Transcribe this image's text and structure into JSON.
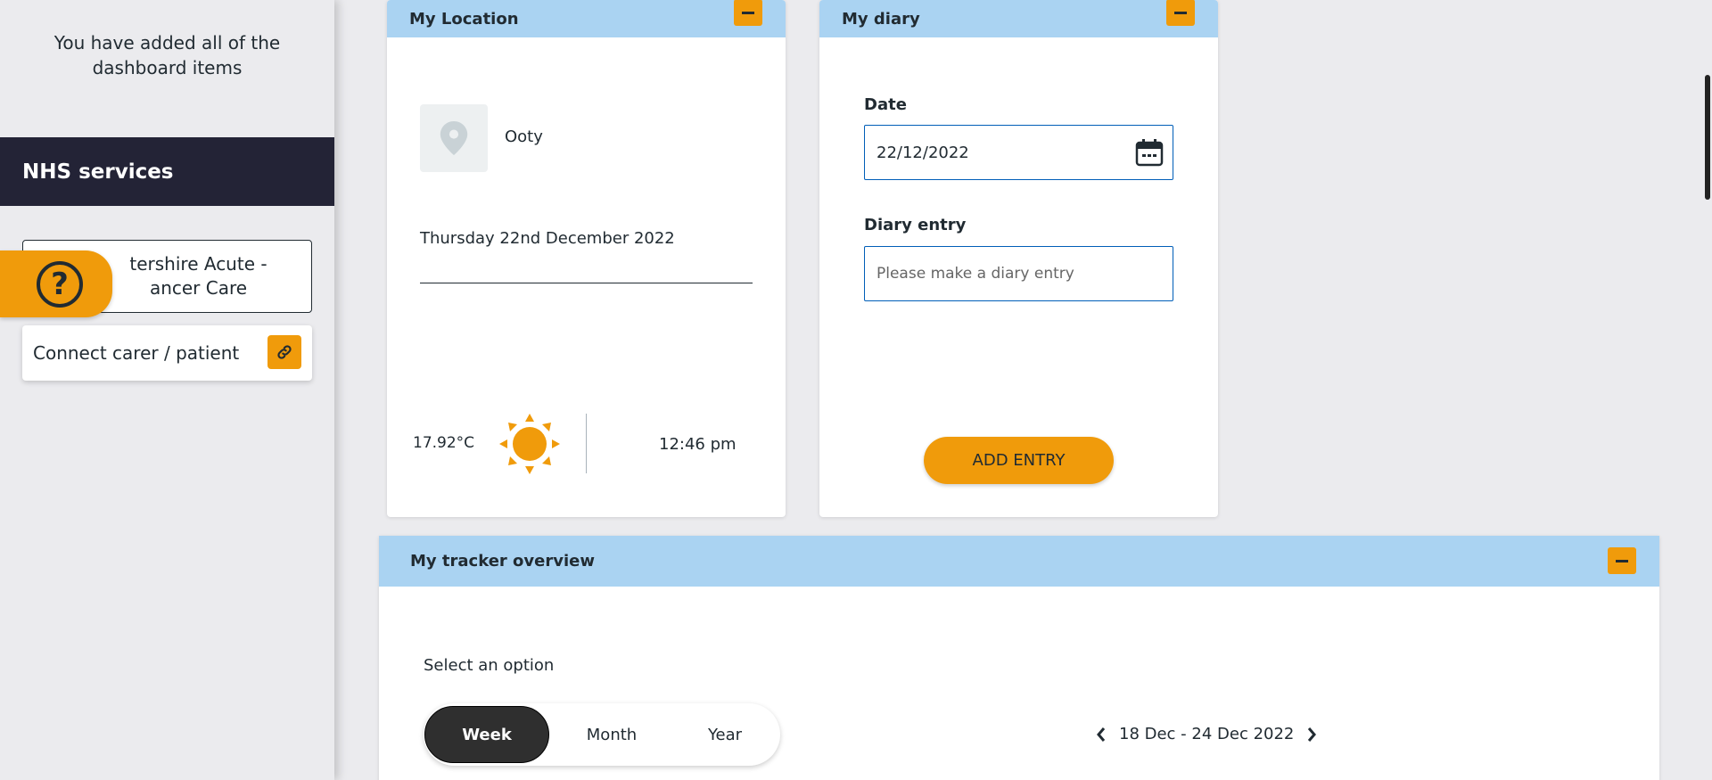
{
  "sidebar": {
    "added_message": "You have added all of the dashboard items",
    "nhs_services_title": "NHS services",
    "service_link_label": "tershire Acute - ancer Care",
    "connect_label": "Connect carer / patient"
  },
  "location": {
    "title": "My Location",
    "place": "Ooty",
    "date": "Thursday 22nd December 2022",
    "temperature": "17.92°C",
    "time": "12:46 pm",
    "weather_icon": "sun-icon"
  },
  "diary": {
    "title": "My diary",
    "date_label": "Date",
    "date_value": "22/12/2022",
    "entry_label": "Diary entry",
    "entry_placeholder": "Please make a diary entry",
    "add_button": "ADD ENTRY"
  },
  "tracker": {
    "title": "My tracker overview",
    "select_label": "Select an option",
    "options": [
      "Week",
      "Month",
      "Year"
    ],
    "selected": "Week",
    "range": "18 Dec - 24 Dec 2022"
  },
  "colors": {
    "accent": "#f09b0b",
    "header_blue": "#aad3f2",
    "nav_dark": "#232336"
  }
}
